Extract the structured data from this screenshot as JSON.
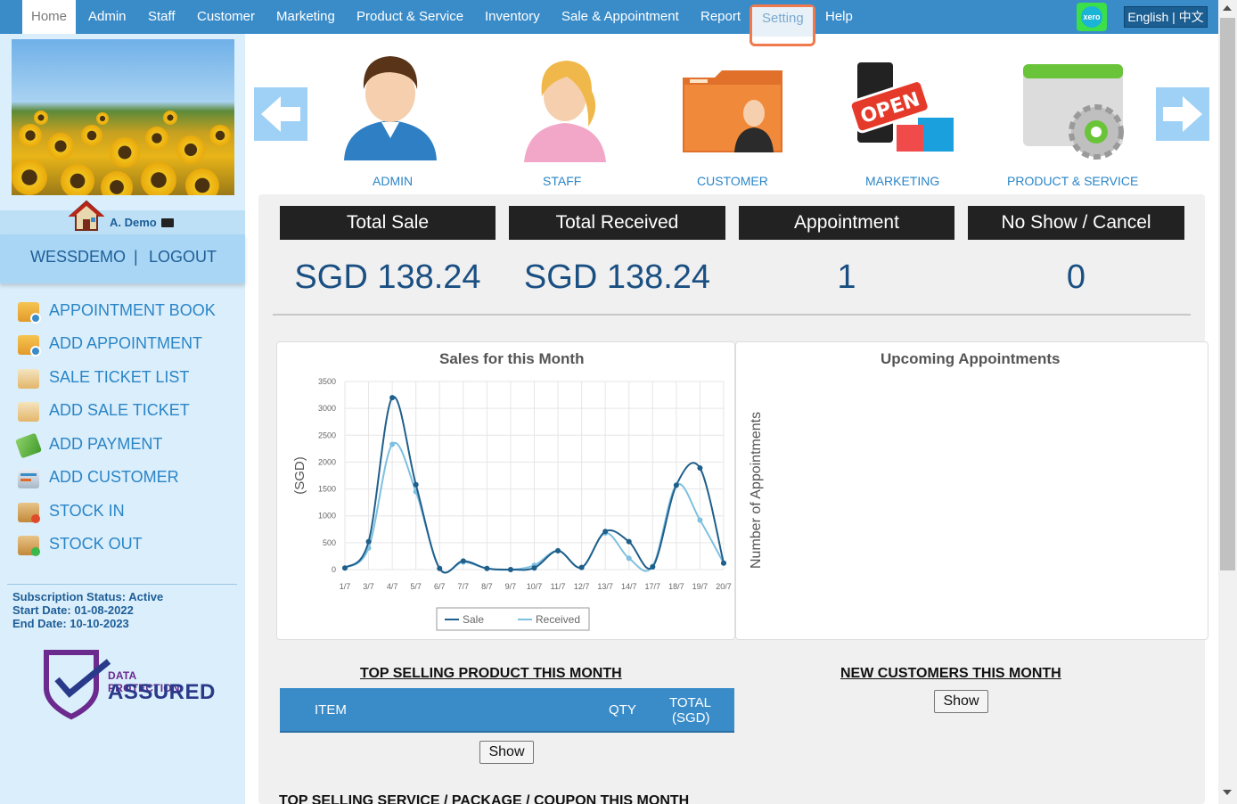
{
  "nav": {
    "items": [
      "Home",
      "Admin",
      "Staff",
      "Customer",
      "Marketing",
      "Product & Service",
      "Inventory",
      "Sale & Appointment",
      "Report",
      "Setting",
      "Help"
    ],
    "xero_label": "xero",
    "language": "English | 中文"
  },
  "sidebar": {
    "user_name": "A. Demo",
    "account": "WESSDEMO",
    "logout": "LOGOUT",
    "separator": "|",
    "menu": [
      {
        "label": "APPOINTMENT BOOK",
        "icon": "calendar-icon"
      },
      {
        "label": "ADD APPOINTMENT",
        "icon": "calendar-add-icon"
      },
      {
        "label": "SALE TICKET LIST",
        "icon": "ticket-list-icon"
      },
      {
        "label": "ADD SALE TICKET",
        "icon": "ticket-add-icon"
      },
      {
        "label": "ADD PAYMENT",
        "icon": "payment-icon"
      },
      {
        "label": "ADD CUSTOMER",
        "icon": "customer-card-icon"
      },
      {
        "label": "STOCK IN",
        "icon": "stock-in-icon"
      },
      {
        "label": "STOCK OUT",
        "icon": "stock-out-icon"
      }
    ],
    "subscription": {
      "status": "Subscription Status: Active",
      "start": "Start Date: 01-08-2022",
      "end": "End Date: 10-10-2023"
    },
    "badge": {
      "line1": "DATA PROTECTION",
      "line2": "ASSURED"
    }
  },
  "carousel": {
    "items": [
      "ADMIN",
      "STAFF",
      "CUSTOMER",
      "MARKETING",
      "PRODUCT & SERVICE"
    ],
    "open_sign": "OPEN"
  },
  "stats": [
    {
      "label": "Total Sale",
      "value": "SGD 138.24"
    },
    {
      "label": "Total Received",
      "value": "SGD 138.24"
    },
    {
      "label": "Appointment",
      "value": "1"
    },
    {
      "label": "No Show / Cancel",
      "value": "0"
    }
  ],
  "chart_data": {
    "type": "line",
    "title": "Sales for this Month",
    "ylabel": "(SGD)",
    "xlabel": "",
    "categories": [
      "1/7",
      "3/7",
      "4/7",
      "5/7",
      "6/7",
      "7/7",
      "8/7",
      "9/7",
      "10/7",
      "11/7",
      "12/7",
      "13/7",
      "14/7",
      "17/7",
      "18/7",
      "19/7",
      "20/7"
    ],
    "series": [
      {
        "name": "Sale",
        "color": "#1f5f8b",
        "values": [
          30,
          520,
          3200,
          1580,
          20,
          160,
          20,
          0,
          30,
          350,
          40,
          710,
          520,
          50,
          1570,
          1890,
          120
        ]
      },
      {
        "name": "Received",
        "color": "#7ec0e0",
        "values": [
          30,
          400,
          2330,
          1450,
          20,
          140,
          20,
          0,
          80,
          350,
          40,
          680,
          210,
          60,
          1570,
          920,
          120
        ]
      }
    ],
    "yticks": [
      0,
      500,
      1000,
      1500,
      2000,
      2500,
      3000,
      3500
    ],
    "ylim": [
      0,
      3500
    ],
    "grid": true,
    "legend": "bottom"
  },
  "appointments": {
    "title": "Upcoming Appointments",
    "ylabel": "Number of Appointments"
  },
  "top_products": {
    "title": "TOP SELLING PRODUCT THIS MONTH",
    "columns": [
      "ITEM",
      "QTY",
      "TOTAL",
      "(SGD)"
    ],
    "show": "Show"
  },
  "new_customers": {
    "title": "NEW CUSTOMERS THIS MONTH",
    "show": "Show"
  },
  "top_services": {
    "title": "TOP SELLING SERVICE / PACKAGE / COUPON THIS MONTH"
  },
  "colors": {
    "nav": "#3a8cc9",
    "sidebar": "#dbeefb",
    "highlight": "#f07a4e",
    "accent": "#1a4f82"
  }
}
